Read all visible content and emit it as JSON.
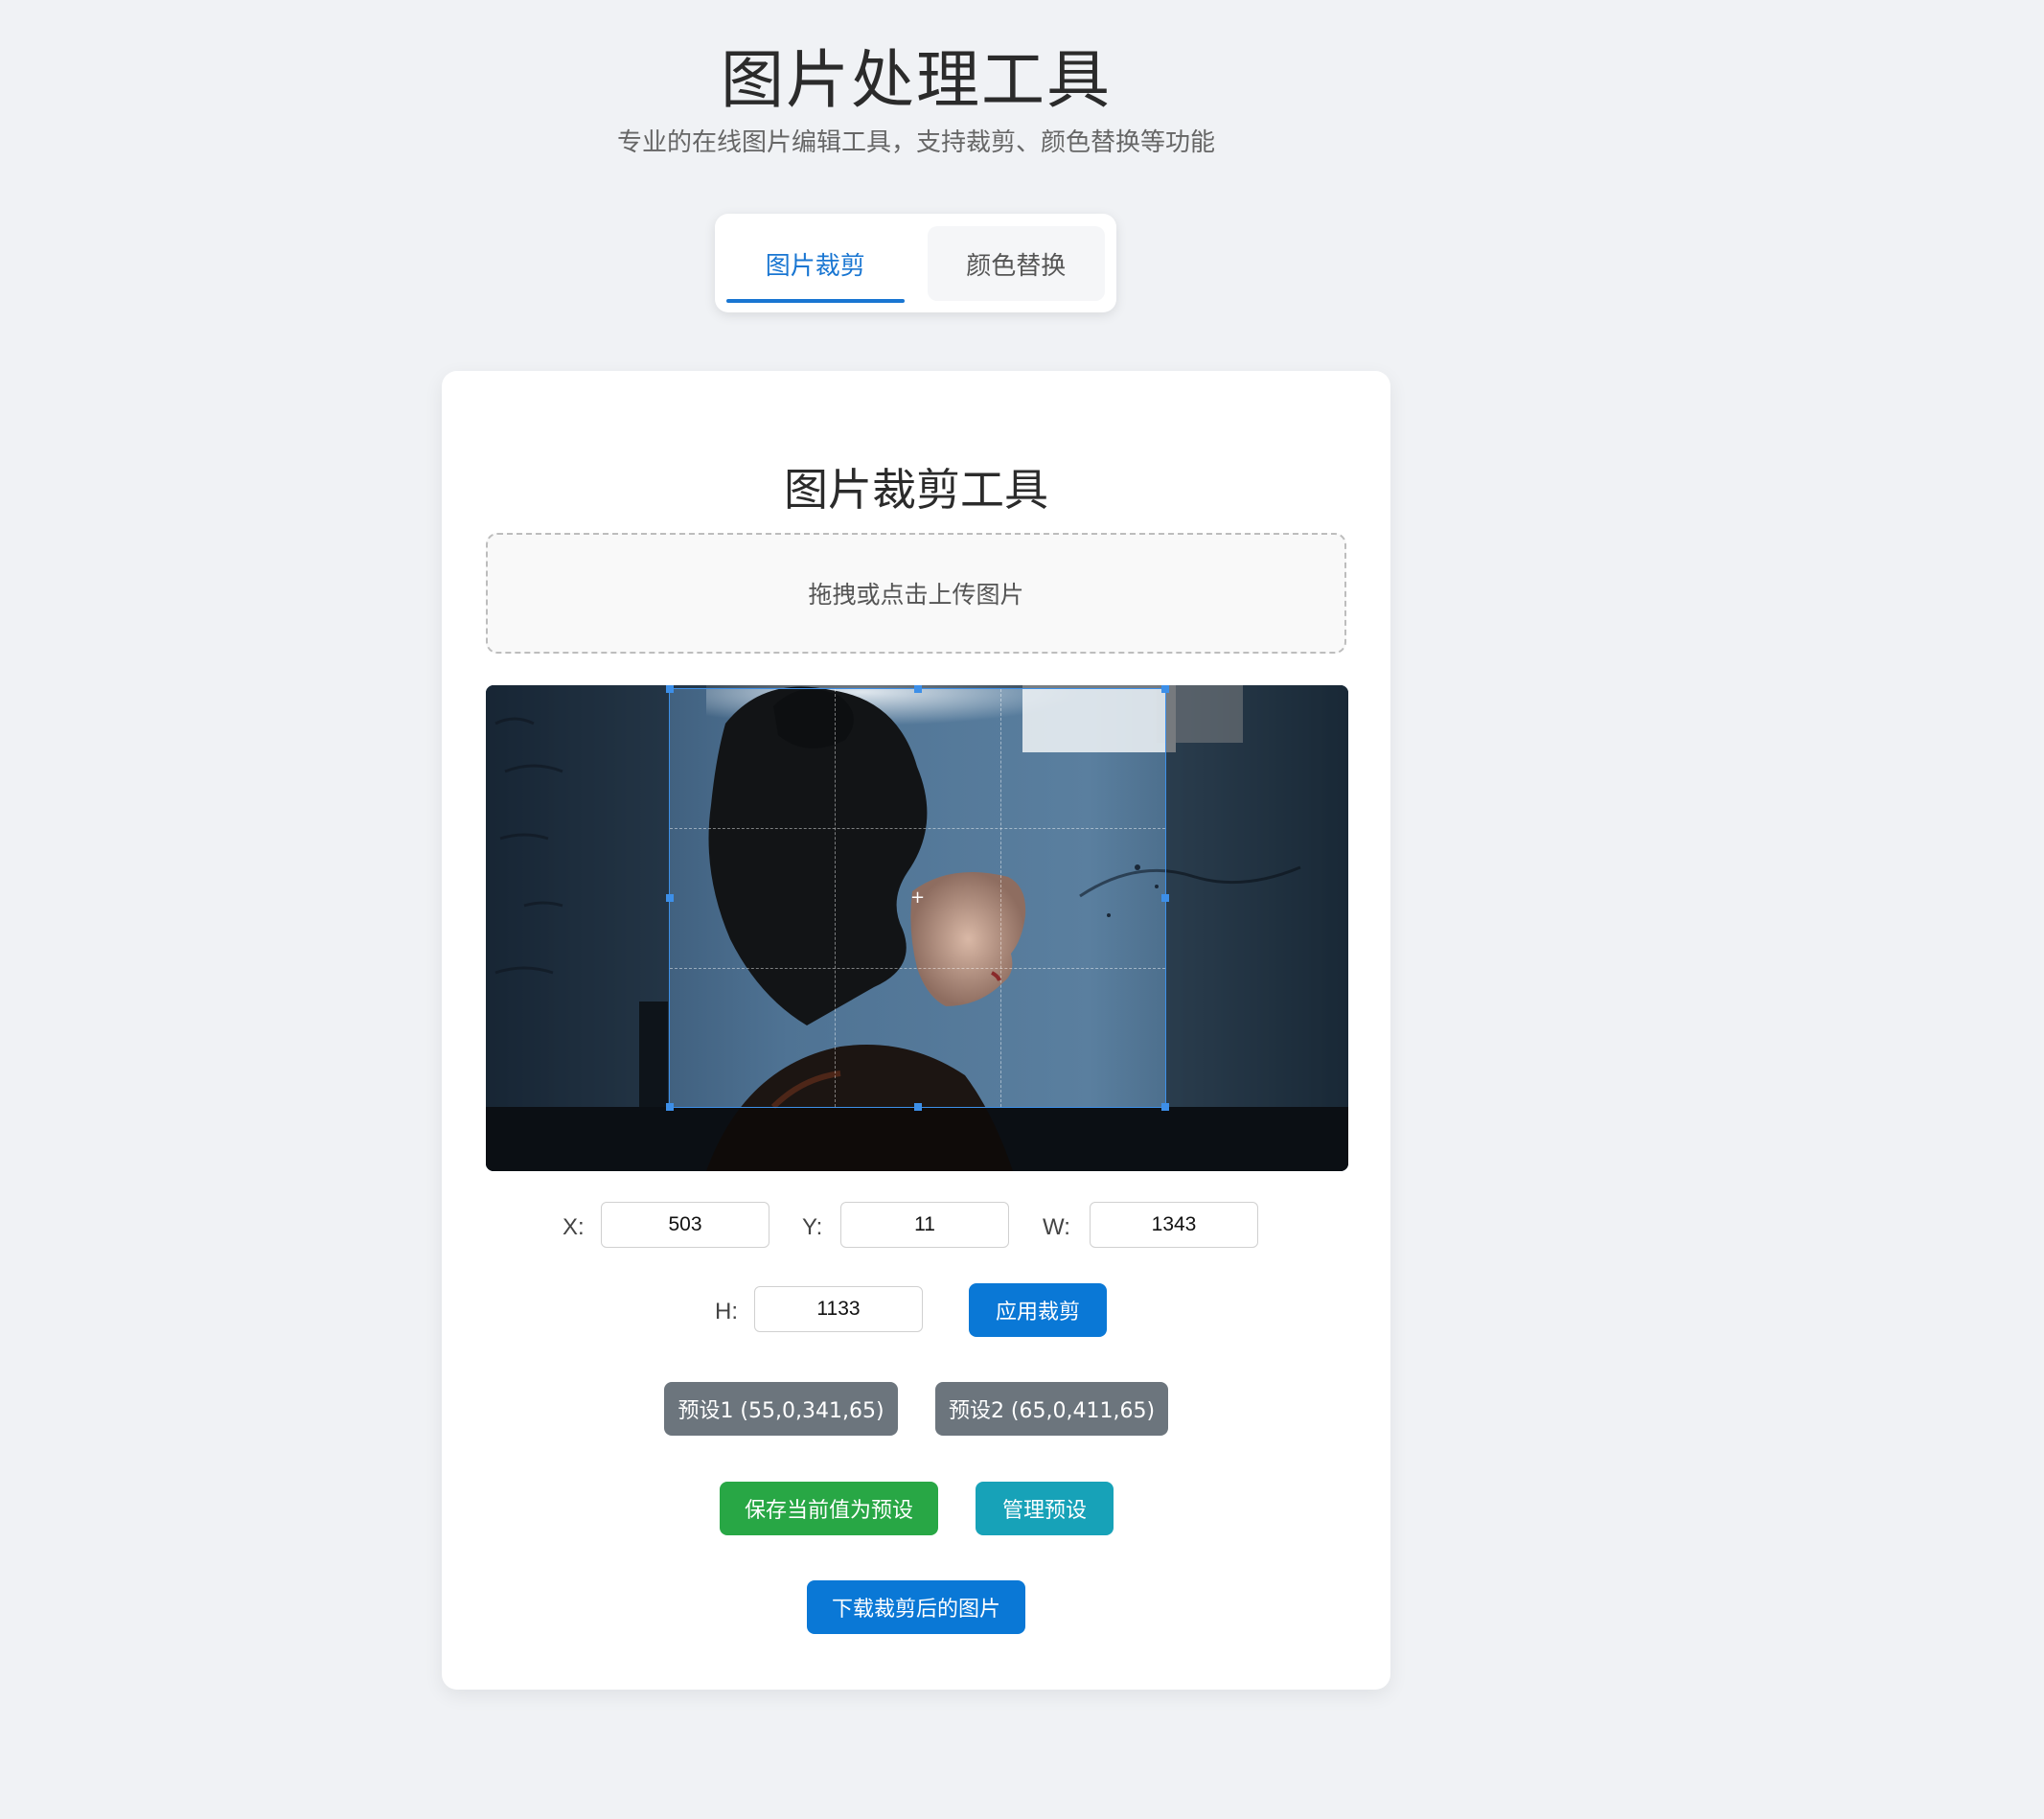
{
  "header": {
    "title": "图片处理工具",
    "subtitle": "专业的在线图片编辑工具，支持裁剪、颜色替换等功能"
  },
  "tabs": [
    {
      "label": "图片裁剪",
      "active": true
    },
    {
      "label": "颜色替换",
      "active": false
    }
  ],
  "crop_tool": {
    "title": "图片裁剪工具",
    "upload_text": "拖拽或点击上传图片",
    "fields": {
      "x": {
        "label": "X:",
        "value": "503"
      },
      "y": {
        "label": "Y:",
        "value": "11"
      },
      "w": {
        "label": "W:",
        "value": "1343"
      },
      "h": {
        "label": "H:",
        "value": "1133"
      }
    },
    "apply_button": "应用裁剪",
    "presets": [
      {
        "label": "预设1 (55,0,341,65)"
      },
      {
        "label": "预设2 (65,0,411,65)"
      }
    ],
    "save_preset_button": "保存当前值为预设",
    "manage_presets_button": "管理预设",
    "download_button": "下载裁剪后的图片"
  },
  "colors": {
    "accent": "#1976d2",
    "primary_button": "#0a78d6",
    "preset_button": "#6c757d",
    "save_button": "#28a745",
    "manage_button": "#17a2b8",
    "background": "#f0f2f5"
  }
}
